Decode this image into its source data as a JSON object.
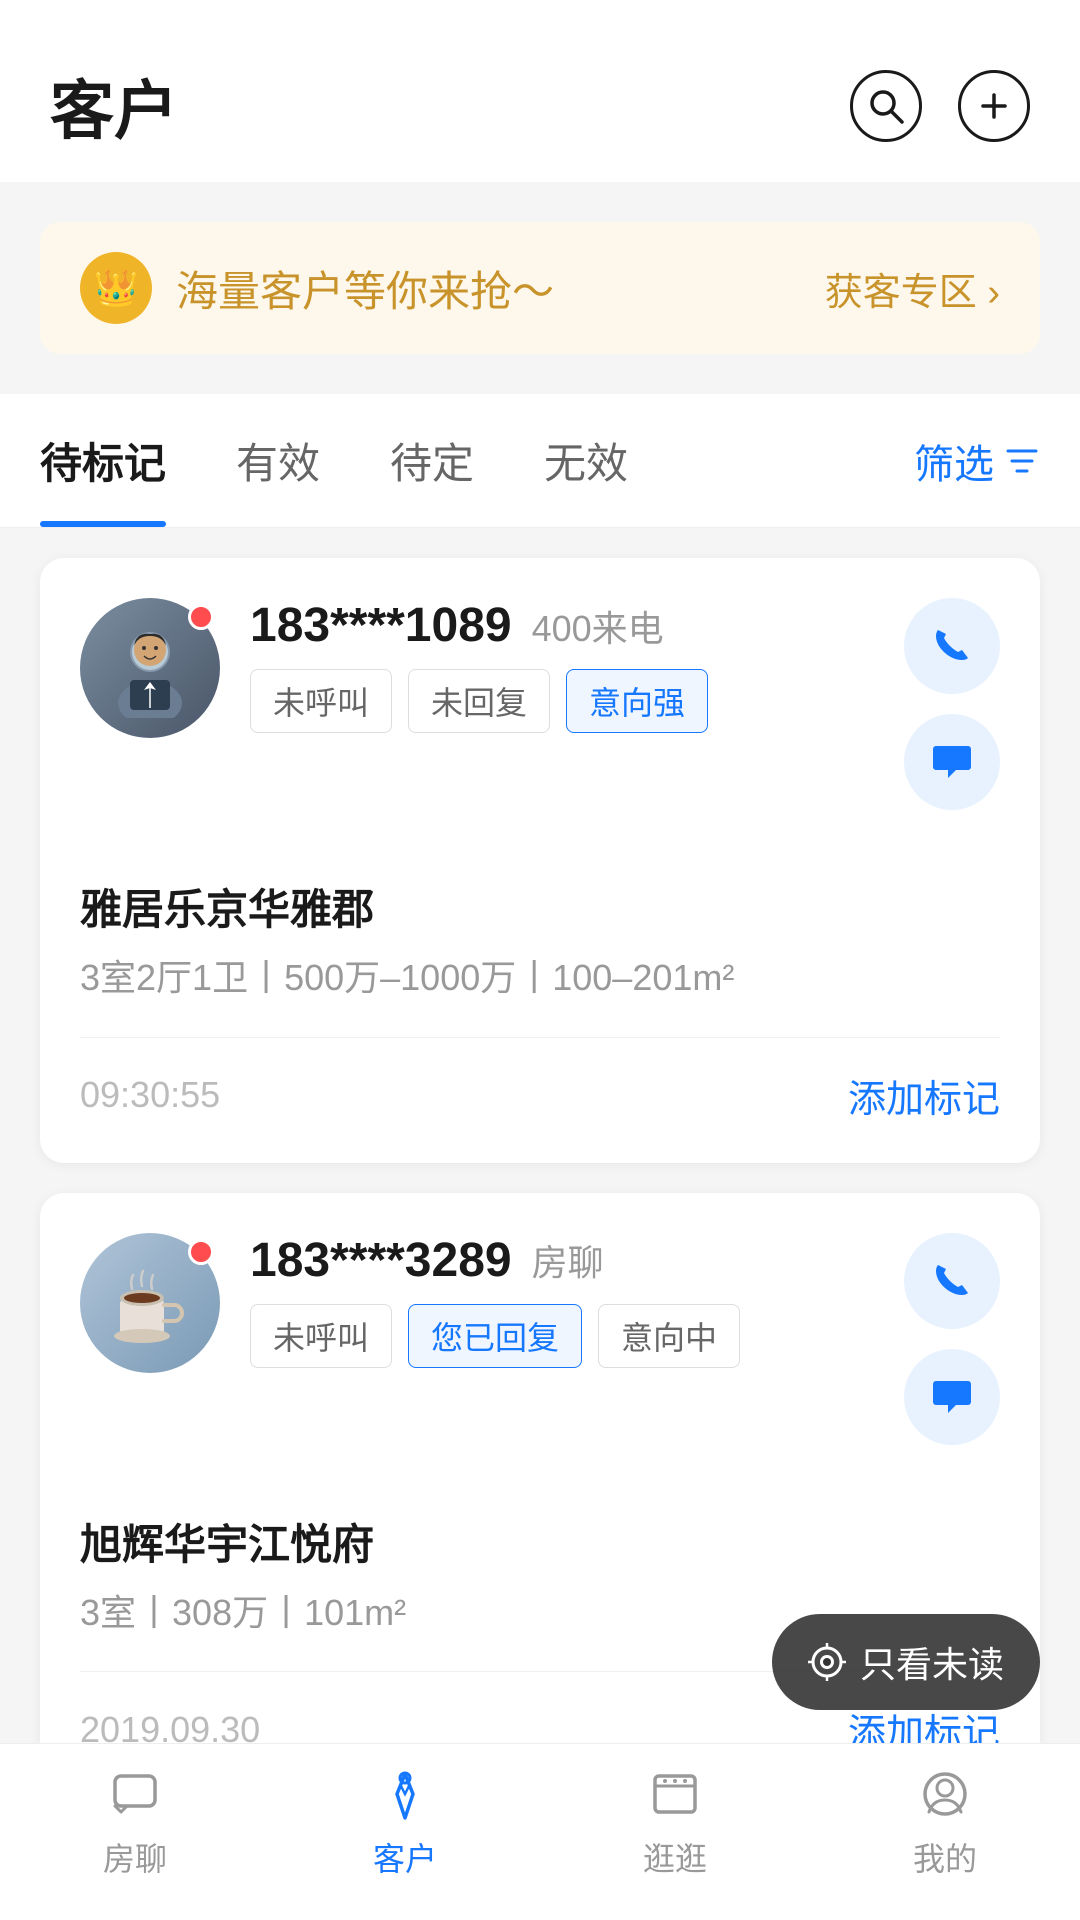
{
  "header": {
    "title": "客户",
    "search_label": "search",
    "add_label": "add"
  },
  "banner": {
    "text": "海量客户等你来抢～",
    "action": "获客专区 ›"
  },
  "tabs": [
    {
      "label": "待标记",
      "active": true
    },
    {
      "label": "有效",
      "active": false
    },
    {
      "label": "待定",
      "active": false
    },
    {
      "label": "无效",
      "active": false
    }
  ],
  "filter_label": "筛选",
  "customers": [
    {
      "phone": "183****1089",
      "source": "400来电",
      "tags": [
        {
          "label": "未呼叫",
          "style": "default"
        },
        {
          "label": "未回复",
          "style": "default"
        },
        {
          "label": "意向强",
          "style": "blue"
        }
      ],
      "property_name": "雅居乐京华雅郡",
      "property_detail": "3室2厅1卫丨500万–1000万丨100–201m²",
      "time": "09:30:55",
      "add_mark_label": "添加标记",
      "avatar_type": "person"
    },
    {
      "phone": "183****3289",
      "source": "房聊",
      "tags": [
        {
          "label": "未呼叫",
          "style": "default"
        },
        {
          "label": "您已回复",
          "style": "blue"
        },
        {
          "label": "意向中",
          "style": "default"
        }
      ],
      "property_name": "旭辉华宇江悦府",
      "property_detail": "3室丨308万丨101m²",
      "time": "2019.09.30",
      "add_mark_label": "添加标记",
      "avatar_type": "coffee"
    }
  ],
  "unread_btn": "只看未读",
  "bottom_nav": [
    {
      "label": "房聊",
      "icon": "chat-icon",
      "active": false
    },
    {
      "label": "客户",
      "icon": "customer-icon",
      "active": true
    },
    {
      "label": "逛逛",
      "icon": "browse-icon",
      "active": false
    },
    {
      "label": "我的",
      "icon": "profile-icon",
      "active": false
    }
  ]
}
